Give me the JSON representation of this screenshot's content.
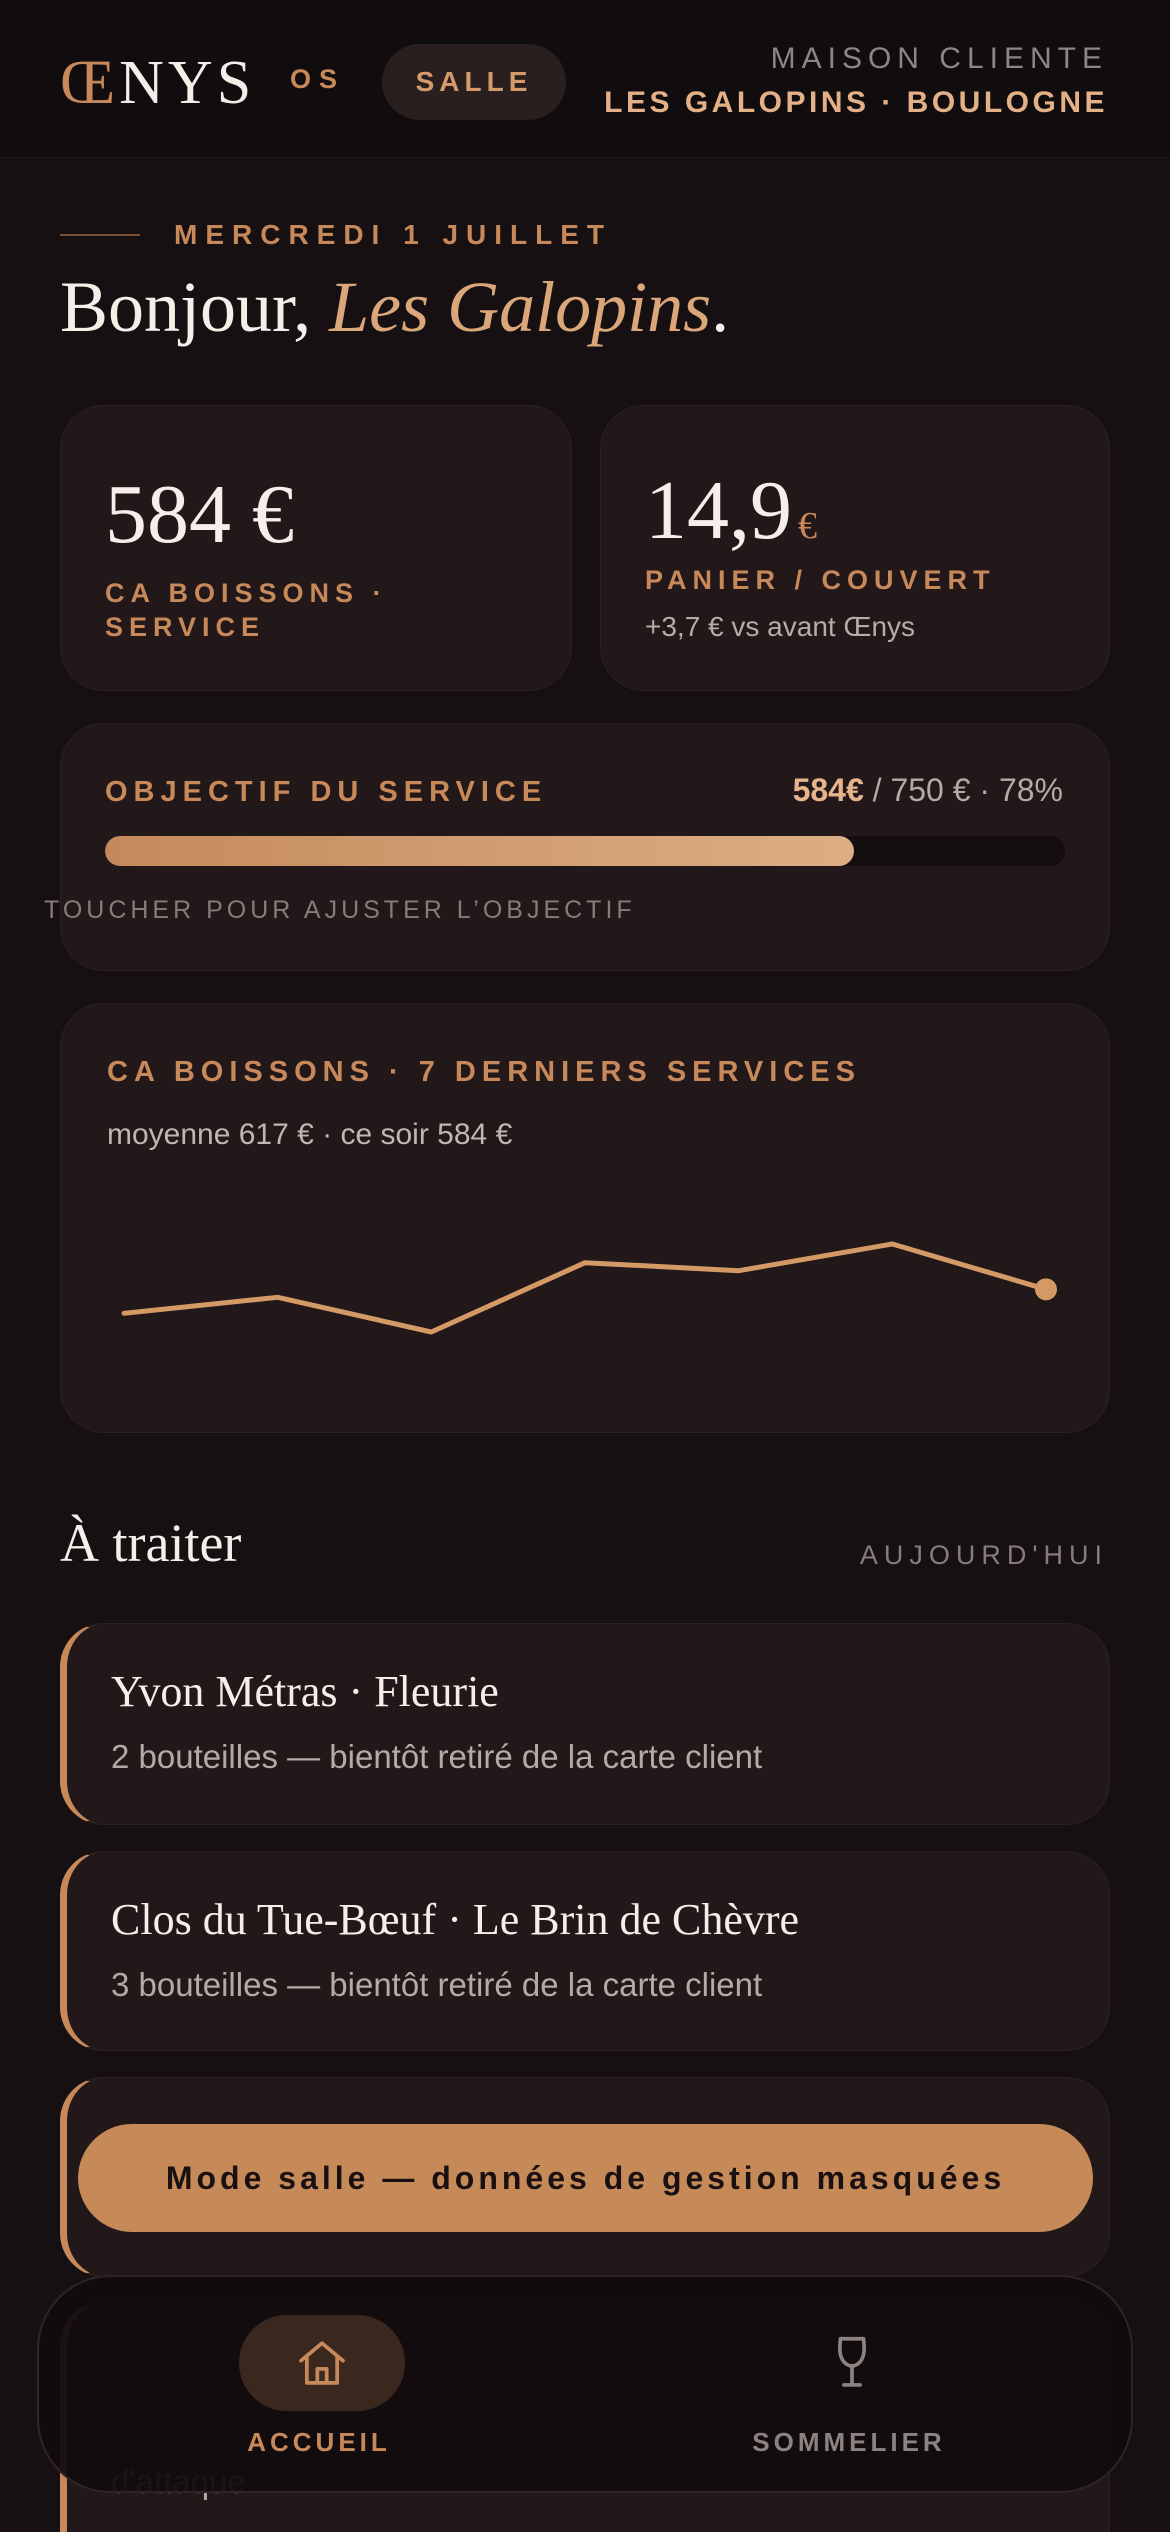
{
  "header": {
    "logo_oe": "Œ",
    "logo_rest": "NYS",
    "logo_suffix": "OS",
    "mode_label": "SALLE",
    "client_label": "MAISON CLIENTE",
    "client_name": "LES GALOPINS · BOULOGNE"
  },
  "greeting": {
    "date": "MERCREDI 1 JUILLET",
    "hello": "Bonjour, ",
    "name": "Les Galopins",
    "punct": "."
  },
  "kpis": [
    {
      "value": "584 €",
      "label": "CA BOISSONS · SERVICE"
    },
    {
      "value": "14,9",
      "unit": "€",
      "label": "PANIER / COUVERT",
      "sub": "+3,7 € vs avant Œnys"
    }
  ],
  "goal": {
    "title": "OBJECTIF DU SERVICE",
    "current": "584€",
    "rest": " / 750 € · 78%",
    "progress_percent": 78,
    "hint": "TOUCHER POUR AJUSTER L’OBJECTIF"
  },
  "chart": {
    "title": "CA BOISSONS · 7 DERNIERS SERVICES",
    "subtitle": "moyenne 617 € · ce soir 584 €"
  },
  "chart_data": {
    "type": "line",
    "title": "CA BOISSONS · 7 DERNIERS SERVICES",
    "series": [
      {
        "values": [
          595,
          625,
          560,
          690,
          675,
          725,
          640
        ]
      }
    ],
    "ylim": [
      500,
      800
    ],
    "grid": false,
    "legend": "none",
    "color": "#d49a66"
  },
  "todo": {
    "title": "À traiter",
    "side": "AUJOURD'HUI",
    "items": [
      {
        "title": "Yvon Métras · Fleurie",
        "sub": "2 bouteilles — bientôt retiré de la carte client"
      },
      {
        "title": "Clos du Tue-Bœuf · Le Brin de Chèvre",
        "sub": "3 bouteilles — bientôt retiré de la carte client"
      },
      {
        "title": "",
        "sub": ""
      },
      {
        "title": "",
        "sub": "d'attaque"
      }
    ]
  },
  "banner": "Mode salle — données de gestion masquées",
  "nav": {
    "home": "ACCUEIL",
    "sommelier": "SOMMELIER"
  },
  "colors": {
    "background": "#161012",
    "card": "#221719",
    "accent": "#c8895a",
    "banner": "#c68a58"
  },
  "icons": {
    "home": "house-icon",
    "sommelier": "wine-glass-icon"
  }
}
